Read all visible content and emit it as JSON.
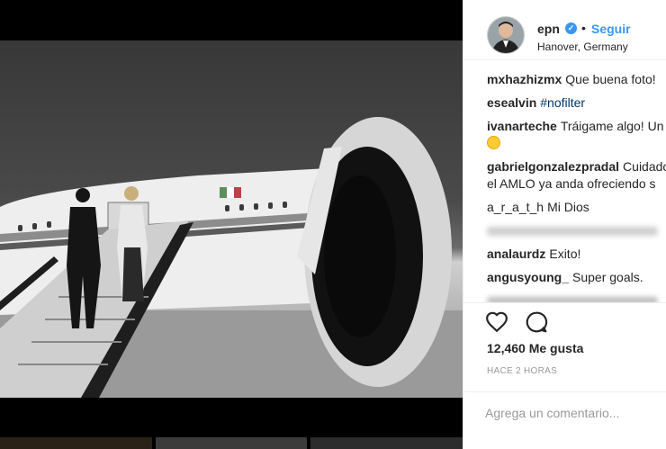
{
  "post": {
    "username": "epn",
    "follow_label": "Seguir",
    "location": "Hanover, Germany",
    "likes": "12,460 Me gusta",
    "time": "HACE 2 HORAS",
    "add_comment_placeholder": "Agrega un comentario..."
  },
  "comments": [
    {
      "user": "mxhazhizmx",
      "text": "Que buena foto!"
    },
    {
      "user": "esealvin",
      "text": "#nofilter",
      "hashtag": true
    },
    {
      "user": "ivanarteche",
      "text": "Tráigame algo! Un",
      "text2": ""
    },
    {
      "user": "gabrielgonzalezpradal",
      "text": "Cuidado",
      "text2": "el AMLO ya anda ofreciendo s"
    },
    {
      "user": "a_r_a_t_h",
      "text": "Mi Dios"
    },
    {
      "user": "",
      "text": "",
      "blurred": true
    },
    {
      "user": "analaurdz",
      "text": "Exito!"
    },
    {
      "user": "angusyoung_",
      "text": "Super goals."
    }
  ],
  "icons": {
    "verified": "verified-badge-icon",
    "like": "heart-icon",
    "comment": "comment-bubble-icon"
  },
  "colors": {
    "link": "#3897f0",
    "text": "#262626",
    "muted": "#999999",
    "verified": "#3897f0"
  }
}
